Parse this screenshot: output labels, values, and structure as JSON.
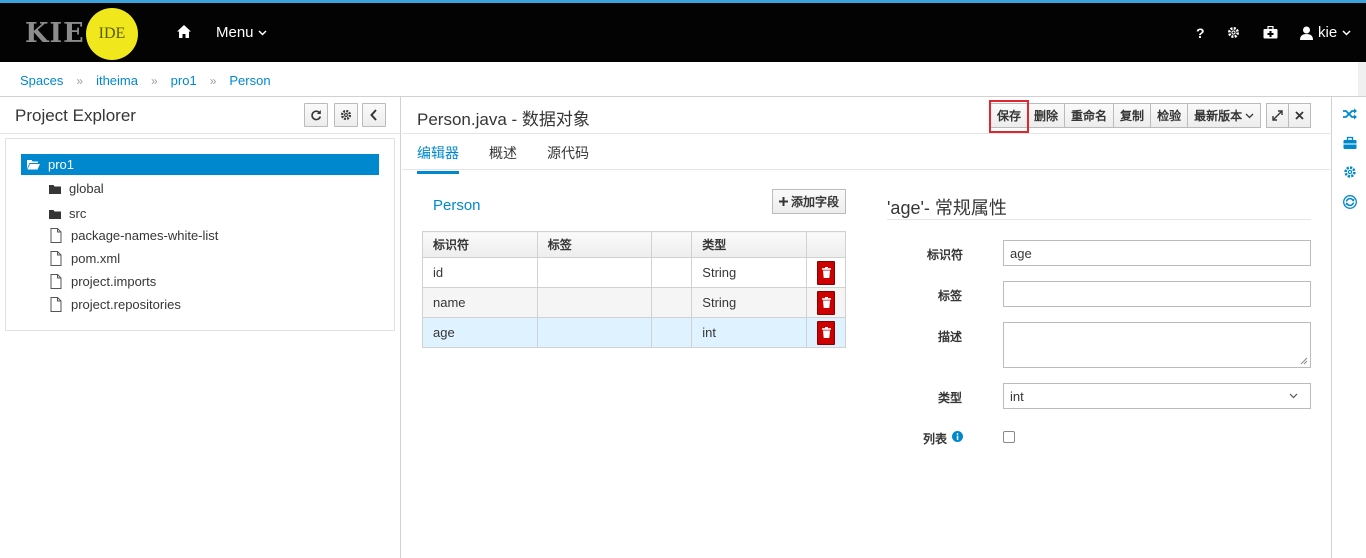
{
  "header": {
    "logo_text": "KIE",
    "logo_badge": "IDE",
    "menu_label": "Menu",
    "help_label": "?",
    "user_label": "kie"
  },
  "breadcrumb": [
    "Spaces",
    "itheima",
    "pro1",
    "Person"
  ],
  "explorer": {
    "title": "Project Explorer",
    "root": "pro1",
    "items": [
      {
        "label": "global",
        "type": "folder"
      },
      {
        "label": "src",
        "type": "folder"
      },
      {
        "label": "package-names-white-list",
        "type": "file"
      },
      {
        "label": "pom.xml",
        "type": "file"
      },
      {
        "label": "project.imports",
        "type": "file"
      },
      {
        "label": "project.repositories",
        "type": "file"
      }
    ]
  },
  "editor": {
    "title": "Person.java - 数据对象",
    "buttons": {
      "save": "保存",
      "delete": "删除",
      "rename": "重命名",
      "copy": "复制",
      "validate": "检验",
      "latest": "最新版本"
    },
    "tabs": [
      "编辑器",
      "概述",
      "源代码"
    ],
    "active_tab": "编辑器"
  },
  "object": {
    "name": "Person",
    "add_field": "添加字段",
    "columns": [
      "标识符",
      "标签",
      "",
      "类型",
      ""
    ],
    "rows": [
      {
        "id": "id",
        "label": "",
        "type": "String"
      },
      {
        "id": "name",
        "label": "",
        "type": "String"
      },
      {
        "id": "age",
        "label": "",
        "type": "int"
      }
    ]
  },
  "properties": {
    "title": "'age'- 常规属性",
    "identifier_label": "标识符",
    "identifier_value": "age",
    "label_label": "标签",
    "label_value": "",
    "description_label": "描述",
    "description_value": "",
    "type_label": "类型",
    "type_value": "int",
    "list_label": "列表"
  },
  "colors": {
    "accent": "#0088ce",
    "navbar": "#030303",
    "logo_yellow": "#f0e81c",
    "danger": "#cc0000",
    "highlight": "#e0262e"
  }
}
